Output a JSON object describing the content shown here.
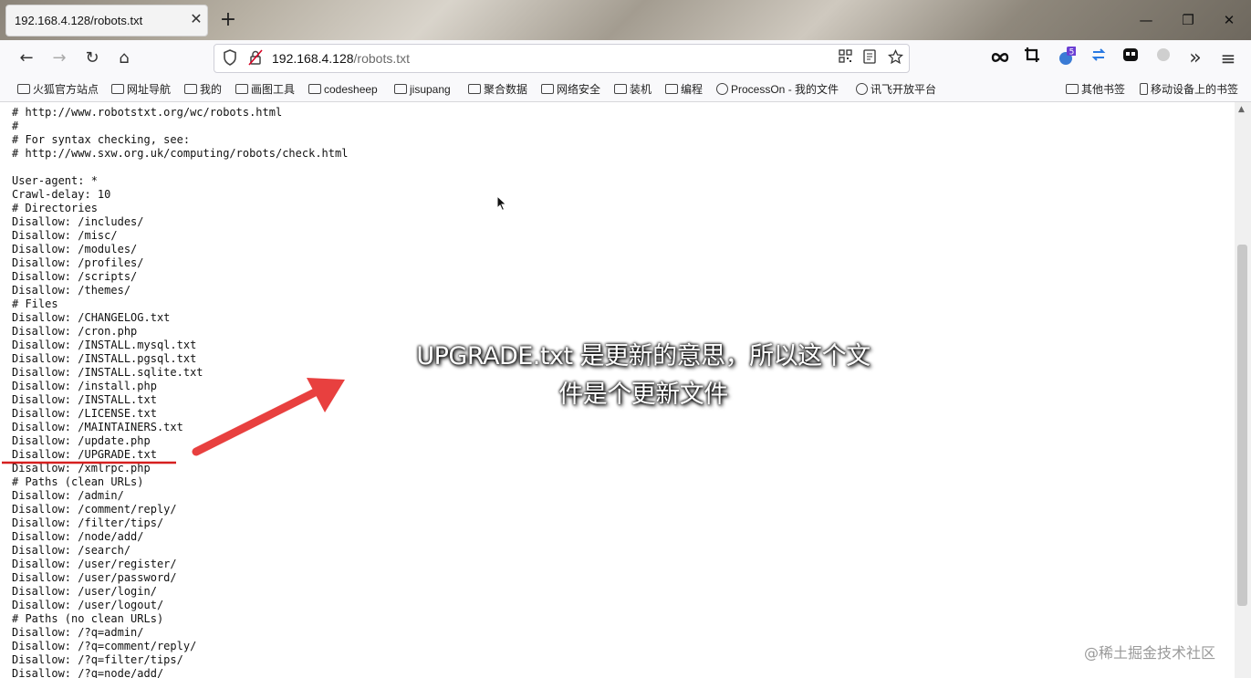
{
  "tab": {
    "title": "192.168.4.128/robots.txt",
    "close": "✕",
    "new_tab": "+"
  },
  "window": {
    "minimize": "—",
    "maximize": "❐",
    "close": "✕"
  },
  "nav": {
    "back": "←",
    "forward": "→",
    "reload": "↻",
    "home": "⌂"
  },
  "address": {
    "host": "192.168.4.128",
    "path": "/robots.txt"
  },
  "toolbar_right": {
    "overflow": "»",
    "menu": "≡",
    "badge": "5"
  },
  "bookmarks": {
    "items": [
      "火狐官方站点",
      "网址导航",
      "我的",
      "画图工具",
      "codesheep",
      "jisupang",
      "聚合数据",
      "网络安全",
      "装机",
      "编程",
      "ProcessOn - 我的文件",
      "讯飞开放平台"
    ],
    "other": "其他书签",
    "mobile": "移动设备上的书签"
  },
  "robots_lines": [
    "# http://www.robotstxt.org/wc/robots.html",
    "#",
    "# For syntax checking, see:",
    "# http://www.sxw.org.uk/computing/robots/check.html",
    "",
    "User-agent: *",
    "Crawl-delay: 10",
    "# Directories",
    "Disallow: /includes/",
    "Disallow: /misc/",
    "Disallow: /modules/",
    "Disallow: /profiles/",
    "Disallow: /scripts/",
    "Disallow: /themes/",
    "# Files",
    "Disallow: /CHANGELOG.txt",
    "Disallow: /cron.php",
    "Disallow: /INSTALL.mysql.txt",
    "Disallow: /INSTALL.pgsql.txt",
    "Disallow: /INSTALL.sqlite.txt",
    "Disallow: /install.php",
    "Disallow: /INSTALL.txt",
    "Disallow: /LICENSE.txt",
    "Disallow: /MAINTAINERS.txt",
    "Disallow: /update.php",
    "Disallow: /UPGRADE.txt",
    "Disallow: /xmlrpc.php",
    "# Paths (clean URLs)",
    "Disallow: /admin/",
    "Disallow: /comment/reply/",
    "Disallow: /filter/tips/",
    "Disallow: /node/add/",
    "Disallow: /search/",
    "Disallow: /user/register/",
    "Disallow: /user/password/",
    "Disallow: /user/login/",
    "Disallow: /user/logout/",
    "# Paths (no clean URLs)",
    "Disallow: /?q=admin/",
    "Disallow: /?q=comment/reply/",
    "Disallow: /?q=filter/tips/",
    "Disallow: /?q=node/add/"
  ],
  "caption": {
    "line1": "UPGRADE.txt 是更新的意思，所以这个文",
    "line2": "件是个更新文件"
  },
  "watermark": "@稀土掘金技术社区",
  "annotation": {
    "arrow_color": "#e8403f",
    "underline_color": "#d61f1f"
  }
}
